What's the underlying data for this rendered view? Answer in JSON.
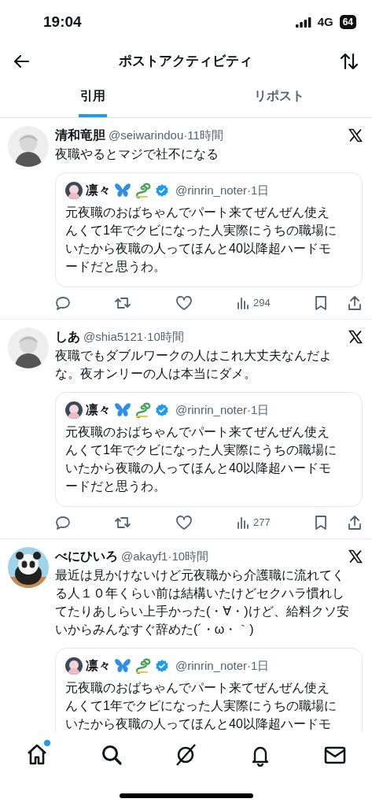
{
  "status_bar": {
    "time": "19:04",
    "network": "4G",
    "battery": "64"
  },
  "header": {
    "title": "ポストアクティビティ"
  },
  "tabs": [
    {
      "label": "引用",
      "selected": true
    },
    {
      "label": "リポスト",
      "selected": false
    }
  ],
  "posts": [
    {
      "name": "清和竜胆",
      "meta": "@seiwarindou·11時間",
      "text_lines": [
        "夜職やるとマジで社不になる"
      ],
      "quote": {
        "name": "凛々",
        "verified": true,
        "meta": "@rinrin_noter·1日",
        "text_lines": [
          "元夜職のおばちゃんでパート来てぜんぜん使え",
          "んくて1年でクビになった人実際にうちの職場に",
          "いたから夜職の人ってほんと40以降超ハードモ",
          "ードだと思うわ。"
        ]
      },
      "views": "294"
    },
    {
      "name": "しあ",
      "meta": "@shia5121·10時間",
      "text_lines": [
        "夜職でもダブルワークの人はこれ大丈夫なんだよ",
        "な。夜オンリーの人は本当にダメ。"
      ],
      "quote": {
        "name": "凛々",
        "verified": true,
        "meta": "@rinrin_noter·1日",
        "text_lines": [
          "元夜職のおばちゃんでパート来てぜんぜん使え",
          "んくて1年でクビになった人実際にうちの職場に",
          "いたから夜職の人ってほんと40以降超ハードモ",
          "ードだと思うわ。"
        ]
      },
      "views": "277"
    },
    {
      "name": "べにひいろ",
      "meta": "@akayf1·10時間",
      "text_lines": [
        "最近は見かけないけど元夜職から介護職に流れてく",
        "る人１０年くらい前は結構いたけどセクハラ慣れし",
        "てたりあしらい上手かった(・∀・)けど、給料クソ安",
        "いからみんなすぐ辞めた(´・ω・｀)"
      ],
      "quote": {
        "name": "凛々",
        "verified": true,
        "meta": "@rinrin_noter·1日",
        "text_lines": [
          "元夜職のおばちゃんでパート来てぜんぜん使え",
          "んくて1年でクビになった人実際にうちの職場に",
          "いたから夜職の人ってほんと40以降超ハードモ"
        ]
      }
    }
  ],
  "nav": [
    {
      "kind": "home",
      "badge": true
    },
    {
      "kind": "search",
      "badge": false
    },
    {
      "kind": "grok",
      "badge": false
    },
    {
      "kind": "bell",
      "badge": false
    },
    {
      "kind": "mail",
      "badge": false
    }
  ]
}
